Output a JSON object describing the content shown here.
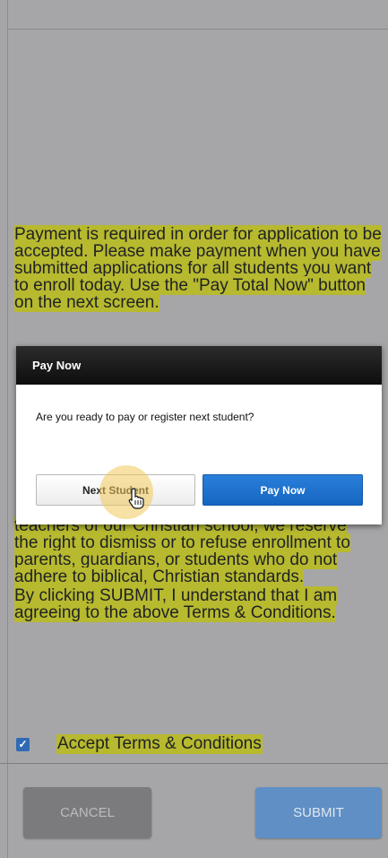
{
  "terms": {
    "p1": "Payment is required in order for application to be accepted. Please make payment when you have submitted applications for all students you want to enroll today. Use the \"Pay Total Now\" button on the next screen.",
    "fragment_a": "teachers of our Christian school, we reserve",
    "fragment_b": "the right to dismiss or to refuse enrollment to parents, guardians, or students who do not adhere to biblical, Christian standards.",
    "p3": "By clicking SUBMIT, I understand that I am agreeing to the above Terms & Conditions."
  },
  "accept": {
    "label": "Accept Terms & Conditions",
    "checked": true
  },
  "footer": {
    "cancel_label": "CANCEL",
    "submit_label": "SUBMIT"
  },
  "dialog": {
    "title": "Pay Now",
    "message": "Are you ready to pay or register next student?",
    "next_label": "Next Student",
    "pay_label": "Pay Now"
  },
  "colors": {
    "highlight": "#b7b92f",
    "primary": "#1d72d1",
    "overlay": "#a6a6a8"
  }
}
